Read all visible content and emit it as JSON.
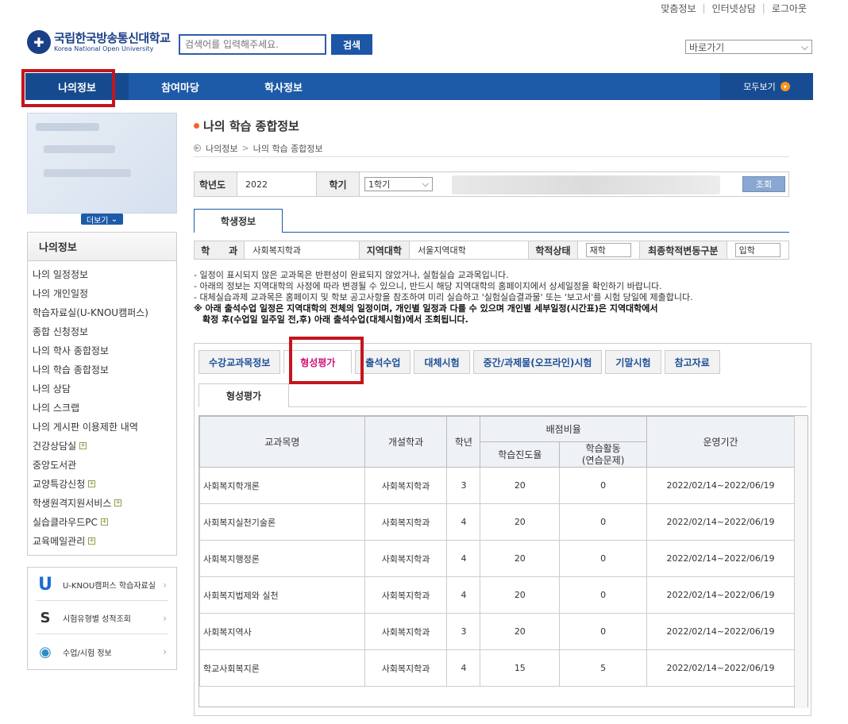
{
  "top_links": [
    "맞춤정보",
    "인터넷상담",
    "로그아웃"
  ],
  "logo": {
    "ko": "국립한국방송통신대학교",
    "en": "Korea National Open University"
  },
  "search": {
    "placeholder": "검색어를 입력해주세요.",
    "button": "검색"
  },
  "quick_select": "바로가기",
  "gnb": {
    "items": [
      "나의정보",
      "참여마당",
      "학사정보"
    ],
    "more": "모두보기"
  },
  "profile": {
    "more": "더보기"
  },
  "lnb": {
    "title": "나의정보",
    "items": [
      {
        "label": "나의 일정정보",
        "expand": false
      },
      {
        "label": "나의 개인일정",
        "expand": false
      },
      {
        "label": "학습자료실(U-KNOU캠퍼스)",
        "expand": false
      },
      {
        "label": "종합 신청정보",
        "expand": false
      },
      {
        "label": "나의 학사 종합정보",
        "expand": false
      },
      {
        "label": "나의 학습 종합정보",
        "expand": false
      },
      {
        "label": "나의 상담",
        "expand": false
      },
      {
        "label": "나의 스크랩",
        "expand": false
      },
      {
        "label": "나의 게시판 이용제한 내역",
        "expand": false
      },
      {
        "label": "건강상담실",
        "expand": true
      },
      {
        "label": "중앙도서관",
        "expand": false
      },
      {
        "label": "교양특강신청",
        "expand": true
      },
      {
        "label": "학생원격지원서비스",
        "expand": true
      },
      {
        "label": "실습클라우드PC",
        "expand": true
      },
      {
        "label": "교육메일관리",
        "expand": true
      }
    ]
  },
  "quick_links": [
    "U-KNOU캠퍼스 학습자료실",
    "시험유형별 성적조회",
    "수업/시험 정보"
  ],
  "page": {
    "title": "나의 학습 종합정보",
    "breadcrumb": [
      "나의정보",
      "나의 학습 종합정보"
    ]
  },
  "filter": {
    "year_label": "학년도",
    "year": "2022",
    "term_label": "학기",
    "term": "1학기",
    "query": "조회"
  },
  "student_tab": "학생정보",
  "student": {
    "dept_label": "학　　과",
    "dept": "사회복지학과",
    "region_label": "지역대학",
    "region": "서울지역대학",
    "status_label": "학적상태",
    "status": "재학",
    "change_label": "최종학적변동구분",
    "change": "입학"
  },
  "notes": [
    "- 일정이 표시되지 않은 교과목은 반편성이 완료되지 않았거나, 실험실습 교과목입니다.",
    "- 아래의 정보는 지역대학의 사정에 따라 변경될 수 있으니, 반드시 해당 지역대학의 홈페이지에서 상세일정을 확인하기 바랍니다.",
    "- 대체실습과제 교과목은 홈페이지 및 학보 공고사항을 참조하여 미리 실습하고 '실험실습결과물' 또는 '보고서'를 시험 당일에 제출합니다."
  ],
  "notice_strong": [
    "※ 아래 출석수업 일정은 지역대학의 전체의 일정이며, 개인별 일정과 다를 수 있으며 개인별 세부일정(시간표)은 지역대학에서",
    "　확정 후(수업일 일주일 전,후) 아래 출석수업(대체시험)에서 조회됩니다."
  ],
  "tabs": [
    "수강교과목정보",
    "형성평가",
    "출석수업",
    "대체시험",
    "중간/과제물(오프라인)시험",
    "기말시험",
    "참고자료"
  ],
  "subtab": "형성평가",
  "table": {
    "headers": {
      "course": "교과목명",
      "dept": "개설학과",
      "year": "학년",
      "ratio": "배점비율",
      "progress": "학습진도율",
      "activity": "학습활동",
      "activity2": "(연습문제)",
      "period": "운영기간"
    },
    "rows": [
      [
        "사회복지학개론",
        "사회복지학과",
        "3",
        "20",
        "0",
        "2022/02/14~2022/06/19"
      ],
      [
        "사회복지실천기술론",
        "사회복지학과",
        "4",
        "20",
        "0",
        "2022/02/14~2022/06/19"
      ],
      [
        "사회복지행정론",
        "사회복지학과",
        "4",
        "20",
        "0",
        "2022/02/14~2022/06/19"
      ],
      [
        "사회복지법제와 실천",
        "사회복지학과",
        "4",
        "20",
        "0",
        "2022/02/14~2022/06/19"
      ],
      [
        "사회복지역사",
        "사회복지학과",
        "3",
        "20",
        "0",
        "2022/02/14~2022/06/19"
      ],
      [
        "학교사회복지론",
        "사회복지학과",
        "4",
        "15",
        "5",
        "2022/02/14~2022/06/19"
      ]
    ]
  }
}
